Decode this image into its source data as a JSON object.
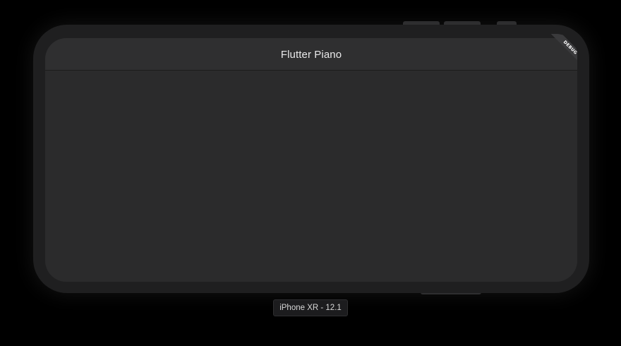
{
  "app": {
    "title": "Flutter Piano",
    "debug_banner": "DEBUG"
  },
  "simulator": {
    "device_label": "iPhone XR - 12.1"
  },
  "colors": {
    "background": "#000000",
    "device_frame": "#1f1f20",
    "screen": "#2b2b2c",
    "appbar": "#2f2f30",
    "title_text": "#e9e9ea"
  }
}
